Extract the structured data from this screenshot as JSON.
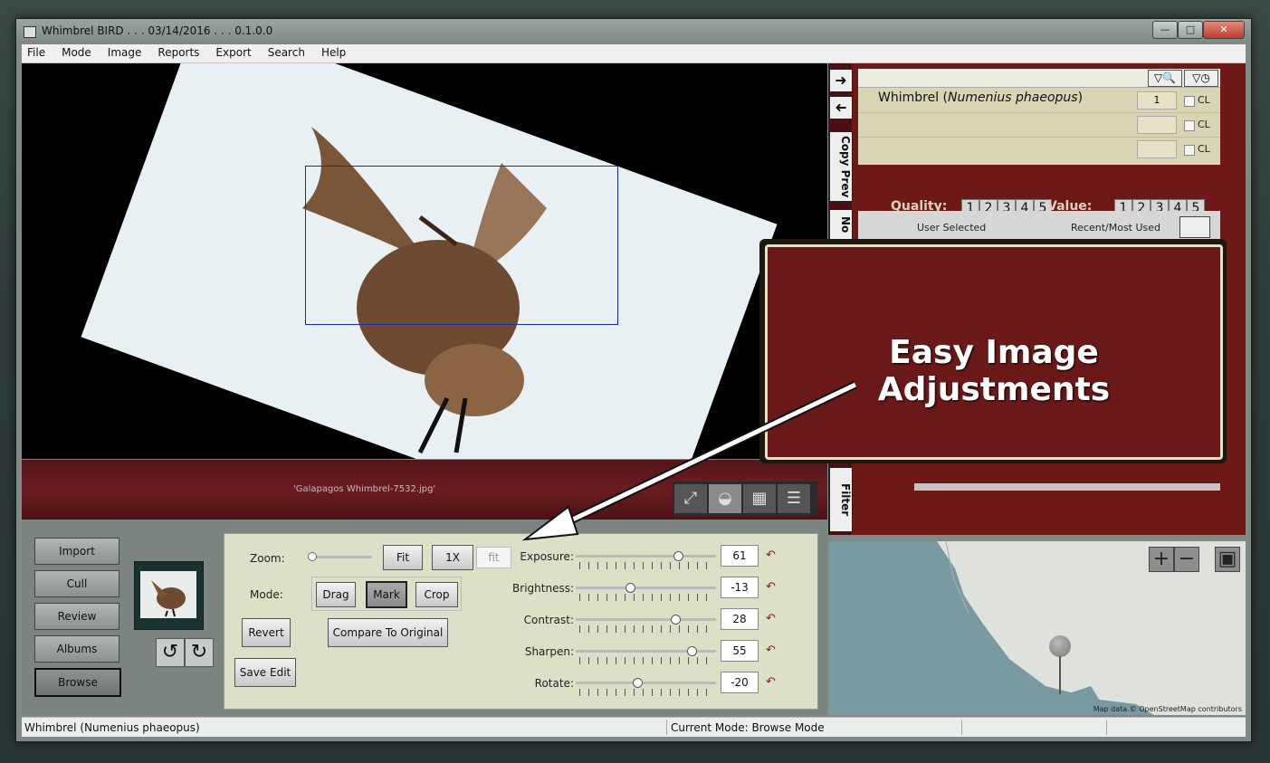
{
  "window": {
    "title": "Whimbrel BIRD . . . 03/14/2016 . . . 0.1.0.0",
    "controls": {
      "minimize": "—",
      "maximize": "□",
      "close": "✕"
    }
  },
  "menu": [
    "File",
    "Mode",
    "Image",
    "Reports",
    "Export",
    "Search",
    "Help"
  ],
  "viewer": {
    "filename": "'Galapagos Whimbrel-7532.jpg'"
  },
  "nav": {
    "import": "Import",
    "cull": "Cull",
    "review": "Review",
    "albums": "Albums",
    "browse": "Browse"
  },
  "edit": {
    "zoom_label": "Zoom:",
    "fit_button": "Fit",
    "onex_button": "1X",
    "fit_field": "fit",
    "mode_label": "Mode:",
    "drag_button": "Drag",
    "mark_button": "Mark",
    "crop_button": "Crop",
    "revert_button": "Revert",
    "compare_button": "Compare To Original",
    "save_button": "Save Edit",
    "sliders": [
      {
        "label": "Exposure:",
        "value": "61",
        "level": 0.75
      },
      {
        "label": "Brightness:",
        "value": "-13",
        "level": 0.4
      },
      {
        "label": "Contrast:",
        "value": "28",
        "level": 0.73
      },
      {
        "label": "Sharpen:",
        "value": "55",
        "level": 0.85
      },
      {
        "label": "Rotate:",
        "value": "-20",
        "level": 0.45
      }
    ]
  },
  "right": {
    "tabs": {
      "copy_prev": "Copy Prev",
      "notes": "No",
      "filter": "Filter"
    },
    "species": [
      {
        "name": "Whimbrel",
        "sci": "Numenius phaeopus",
        "count": "1",
        "cl": "CL"
      },
      {
        "name": "",
        "sci": "",
        "count": "",
        "cl": "CL"
      },
      {
        "name": "",
        "sci": "",
        "count": "",
        "cl": "CL"
      }
    ],
    "quality_label": "Quality:",
    "value_label": "Value:",
    "ratings": [
      "1",
      "2",
      "3",
      "4",
      "5"
    ],
    "tag_header_left": "User Selected",
    "tag_header_right": "Recent/Most Used"
  },
  "callout": {
    "text": "Easy Image Adjustments"
  },
  "map": {
    "zoom_in": "+",
    "zoom_out": "−",
    "attribution": "Map data © OpenStreetMap contributors"
  },
  "status": {
    "left": "Whimbrel (Numenius phaeopus)",
    "mode": "Current Mode: Browse Mode"
  }
}
